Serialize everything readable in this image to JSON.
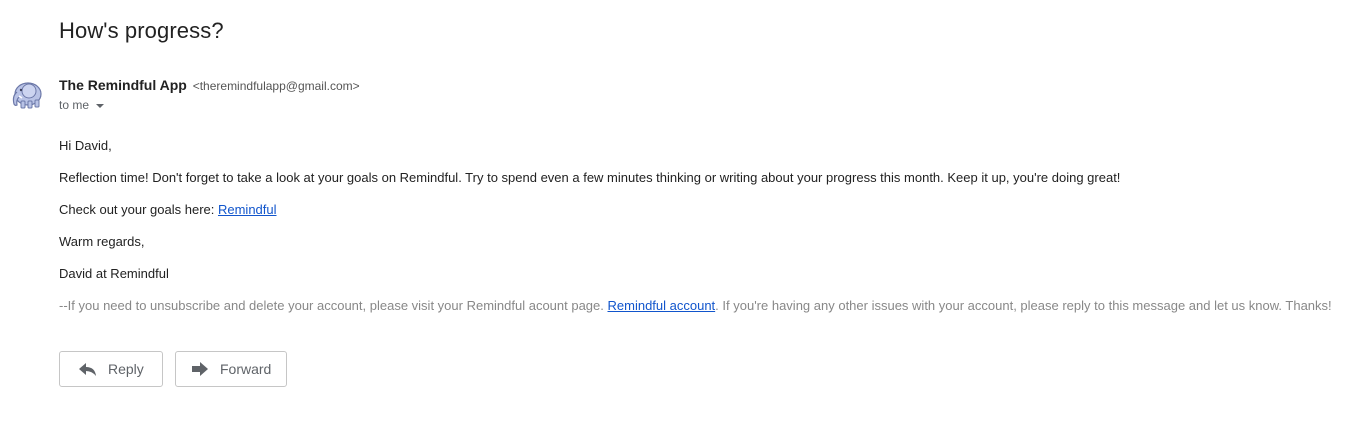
{
  "email": {
    "subject": "How's progress?",
    "sender_name": "The Remindful App",
    "sender_email": "<theremindfulapp@gmail.com>",
    "to_label": "to me",
    "avatar_icon": "elephant-icon"
  },
  "body": {
    "greeting": "Hi David,",
    "paragraph1": "Reflection time! Don't forget to take a look at your goals on Remindful. Try to spend even a few minutes thinking or writing about your progress this month. Keep it up, you're doing great!",
    "check_prefix": "Check out your goals here: ",
    "check_link": "Remindful",
    "closing": "Warm regards,",
    "signature": "David at Remindful",
    "footer_prefix": "--If you need to unsubscribe and delete your account, please visit your Remindful acount page. ",
    "footer_link": "Remindful account",
    "footer_suffix": ". If you're having any other issues with your account, please reply to this message and let us know. Thanks!"
  },
  "actions": {
    "reply_label": "Reply",
    "forward_label": "Forward",
    "reply_icon": "reply-arrow-icon",
    "forward_icon": "forward-arrow-icon"
  },
  "colors": {
    "link": "#1155cc",
    "muted": "#888888",
    "text": "#222222"
  }
}
